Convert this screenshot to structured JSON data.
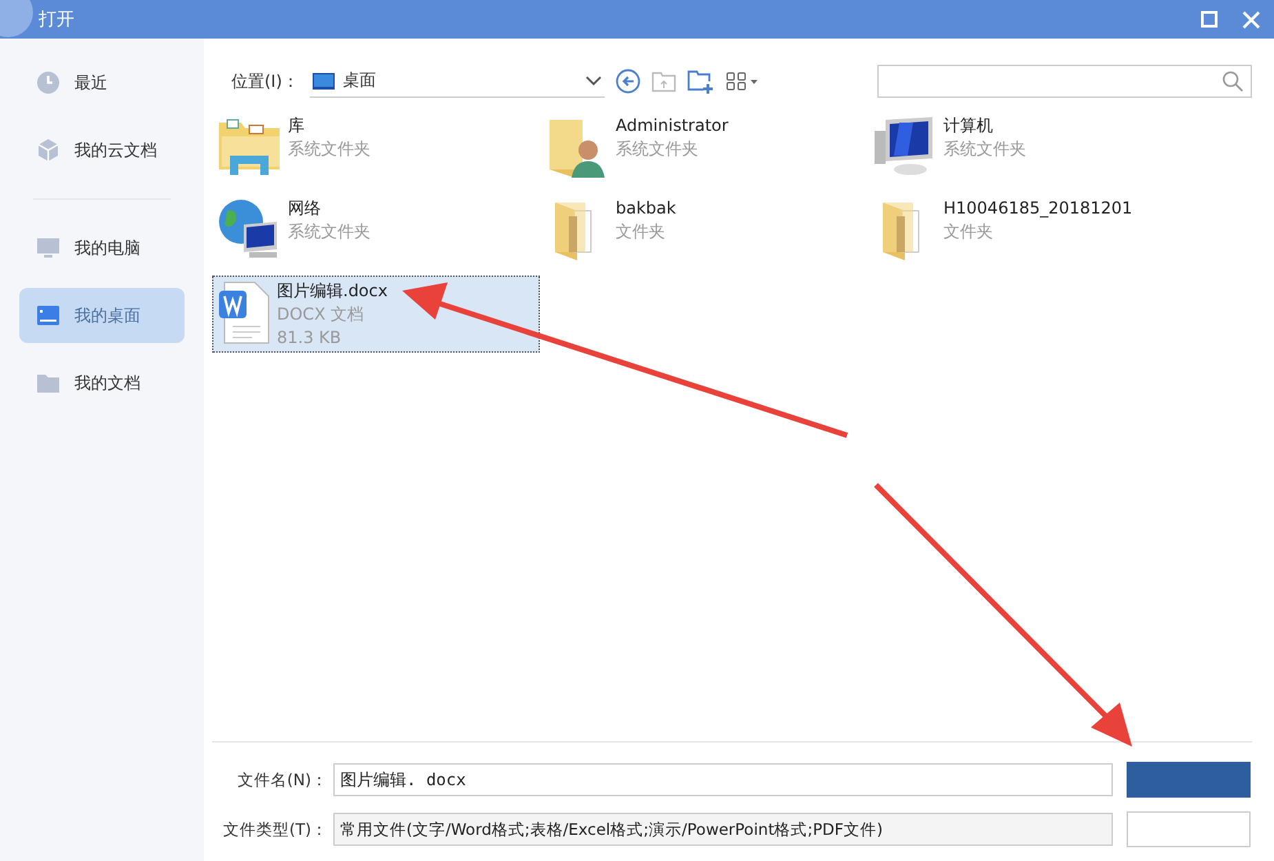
{
  "window": {
    "title": "打开"
  },
  "sidebar": {
    "items": [
      {
        "label": "最近",
        "selected": false
      },
      {
        "label": "我的云文档",
        "selected": false
      },
      {
        "label": "我的电脑",
        "selected": false
      },
      {
        "label": "我的桌面",
        "selected": true
      },
      {
        "label": "我的文档",
        "selected": false
      }
    ]
  },
  "location": {
    "label": "位置(I)：",
    "value": "桌面"
  },
  "files": [
    {
      "name": "库",
      "type": "系统文件夹",
      "kind": "library",
      "selected": false
    },
    {
      "name": "Administrator",
      "type": "系统文件夹",
      "kind": "user",
      "selected": false
    },
    {
      "name": "计算机",
      "type": "系统文件夹",
      "kind": "computer",
      "selected": false
    },
    {
      "name": "网络",
      "type": "系统文件夹",
      "kind": "network",
      "selected": false
    },
    {
      "name": "bakbak",
      "type": "文件夹",
      "kind": "folder",
      "selected": false
    },
    {
      "name": "H10046185_20181201",
      "type": "文件夹",
      "kind": "folder",
      "selected": false
    },
    {
      "name": "图片编辑.docx",
      "type": "DOCX 文档",
      "size": "81.3 KB",
      "kind": "doc",
      "selected": true
    }
  ],
  "filename": {
    "label": "文件名(N)：",
    "value": "图片编辑. docx"
  },
  "filetype": {
    "label": "文件类型(T)：",
    "value": "常用文件(文字/Word格式;表格/Excel格式;演示/PowerPoint格式;PDF文件)"
  }
}
